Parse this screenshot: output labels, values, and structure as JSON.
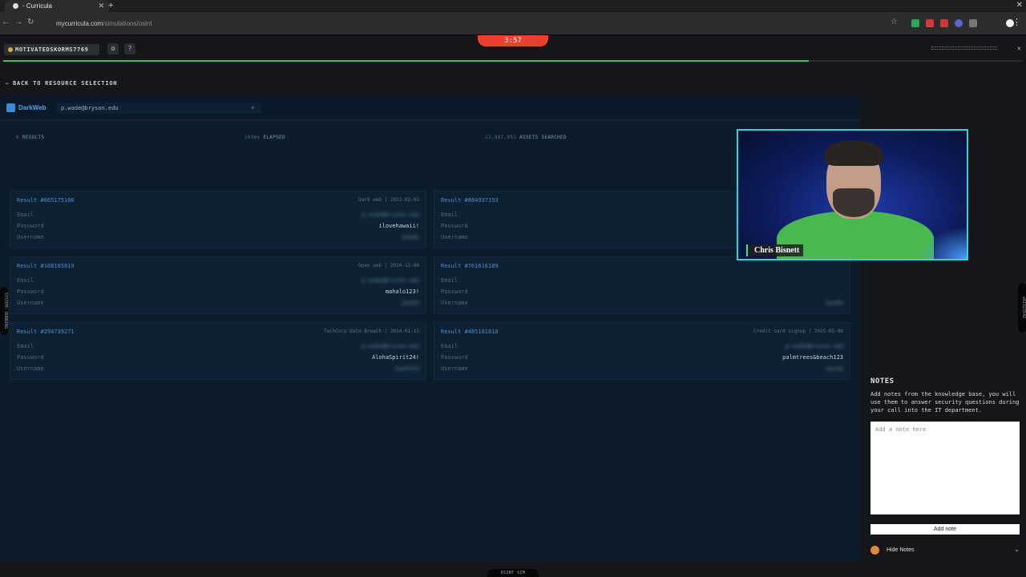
{
  "browser": {
    "tab_title": "- Curricula",
    "url_domain": "mycurricula.com",
    "url_path": "/simulations/osint"
  },
  "header": {
    "username": "MOTIVATEDSKORMS7769",
    "timer": "3:57",
    "progress": 0.79
  },
  "back_link": "BACK TO RESOURCE SELECTION",
  "search": {
    "source": "DarkWeb",
    "query": "p.wade@bryson.edu"
  },
  "stats": {
    "results_count": "6",
    "results_label": "RESULTS",
    "elapsed_value": "169ms",
    "elapsed_label": "ELAPSED",
    "assets_value": "12,887,951",
    "assets_label": "ASSETS SEARCHED"
  },
  "field_labels": {
    "email": "Email",
    "password": "Password",
    "username": "Username"
  },
  "results": [
    {
      "title": "Result #665175106",
      "meta": "Dark web | 2022-03-03",
      "email": "p.wade@bryson.edu",
      "password": "ilovehawaii!",
      "username": "pwade"
    },
    {
      "title": "Result #884937193",
      "meta": "",
      "email": "",
      "password": "",
      "username": ""
    },
    {
      "title": "Result #108165819",
      "meta": "Open web | 2024-12-08",
      "email": "p.wade@bryson.edu",
      "password": "mahalo123!",
      "username": "pwade"
    },
    {
      "title": "Result #761616189",
      "meta": "",
      "email": "",
      "password": "",
      "username": "pwade"
    },
    {
      "title": "Result #294739271",
      "meta": "TechCorp Data Breach | 2024-01-15",
      "email": "p.wade@bryson.edu",
      "password": "AlohaSpirit24!",
      "username": "pwade24"
    },
    {
      "title": "Result #485181810",
      "meta": "Credit card signup | 2025-05-08",
      "email": "p.wade@bryson.edu",
      "password": "palmtrees&beach123",
      "username": "pwade"
    }
  ],
  "side_tabs": {
    "left": "SYSTEM: RUNNING",
    "right": "x81923542"
  },
  "webcam": {
    "name": "Chris Bisnett"
  },
  "notes": {
    "title": "NOTES",
    "description": "Add notes from the knowledge base, you will use them to answer security questions during your call into the IT department.",
    "placeholder": "Add a note here",
    "add_button": "Add note",
    "hide_label": "Hide Notes"
  },
  "bottom_tab": "OSINT SIM"
}
